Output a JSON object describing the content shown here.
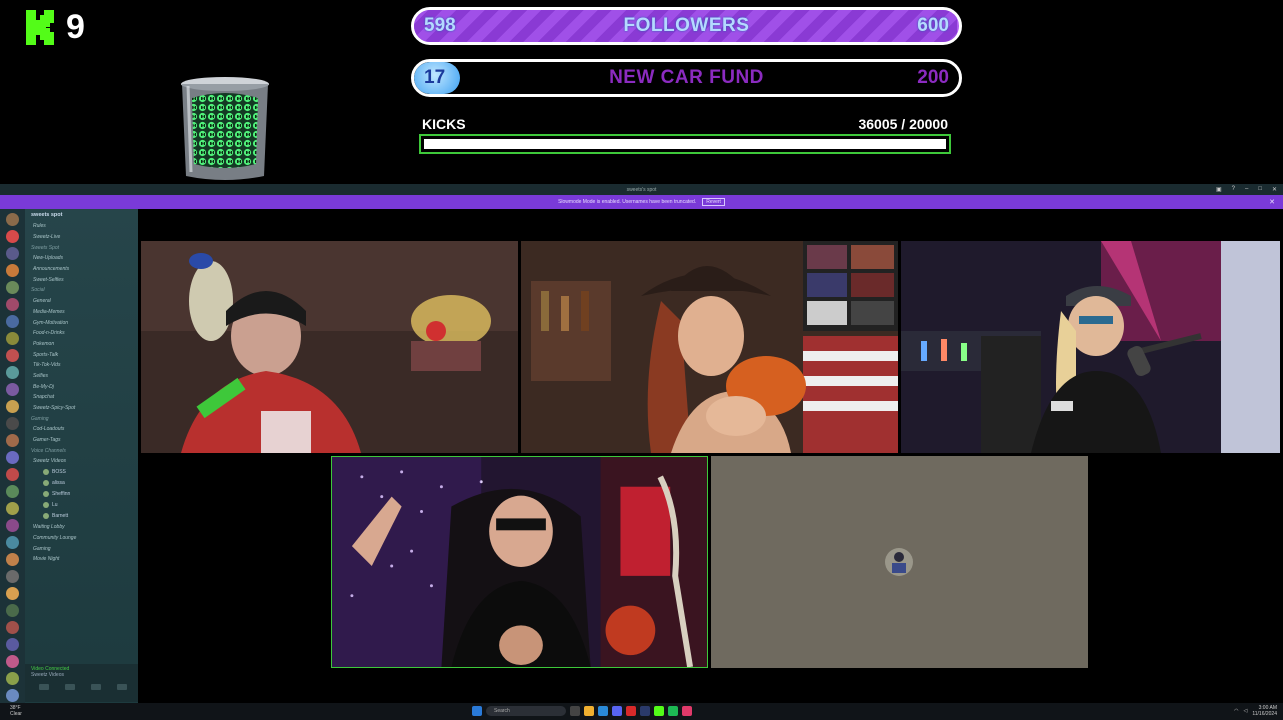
{
  "overlay": {
    "logo_letter": "K",
    "logo_number": "9",
    "followers_goal": {
      "start": "598",
      "title": "FOLLOWERS",
      "end": "600",
      "progress": 0.9967
    },
    "car_goal": {
      "start": "17",
      "title": "NEW CAR FUND",
      "end": "200",
      "progress": 0.085
    },
    "kicks": {
      "label": "KICKS",
      "count": "36005 / 20000",
      "progress": 1.0
    }
  },
  "discord": {
    "window_title": "sweets's spot",
    "banner": {
      "text": "Slowmode Mode is enabled. Usernames have been truncated.",
      "revert_label": "Revert"
    },
    "server_name": "sweets spot",
    "channels": [
      {
        "kind": "item",
        "label": "Rules"
      },
      {
        "kind": "item",
        "label": "Sweetz-Live"
      },
      {
        "kind": "cat",
        "label": "Sweets Spot"
      },
      {
        "kind": "item",
        "label": "New-Uploads"
      },
      {
        "kind": "item",
        "label": "Announcements"
      },
      {
        "kind": "item",
        "label": "Sweet-Selfies"
      },
      {
        "kind": "cat",
        "label": "Social"
      },
      {
        "kind": "item",
        "label": "General"
      },
      {
        "kind": "item",
        "label": "Media-Memes"
      },
      {
        "kind": "item",
        "label": "Gym-Motivation"
      },
      {
        "kind": "item",
        "label": "Food-n-Drinks"
      },
      {
        "kind": "item",
        "label": "Pokemon"
      },
      {
        "kind": "item",
        "label": "Sports-Talk"
      },
      {
        "kind": "item",
        "label": "Tik-Tok-Vids"
      },
      {
        "kind": "item",
        "label": "Selfies"
      },
      {
        "kind": "item",
        "label": "Be-My-Dj"
      },
      {
        "kind": "item",
        "label": "Snapchat"
      },
      {
        "kind": "item",
        "label": "Sweetz-Spicy-Spot"
      },
      {
        "kind": "cat",
        "label": "Gaming"
      },
      {
        "kind": "item",
        "label": "Cod-Loadouts"
      },
      {
        "kind": "item",
        "label": "Gamer-Tags"
      },
      {
        "kind": "cat",
        "label": "Voice Channels"
      },
      {
        "kind": "item",
        "label": "Sweetz Videos"
      }
    ],
    "voice_users": [
      "BOSS",
      "alissa",
      "Sheffinn",
      "Lu",
      "Barnett"
    ],
    "more_channels": [
      {
        "label": "Waiting Lobby"
      },
      {
        "label": "Community Lounge"
      },
      {
        "label": "Gaming"
      },
      {
        "label": "Movie Night"
      }
    ],
    "voice_panel": {
      "status": "Video Connected",
      "channel": "Sweetz Videos"
    }
  },
  "taskbar": {
    "weather_temp": "38°F",
    "weather_desc": "Clear",
    "search_placeholder": "Search",
    "time": "3:00 AM",
    "date": "11/16/2024"
  },
  "colors": {
    "followers_bar": "#9b4ee6",
    "car_fill": "#3ea1f2",
    "kicks_border": "#3ec83a",
    "discord_banner": "#7a3ad8",
    "discord_sidebar": "#26454a"
  }
}
